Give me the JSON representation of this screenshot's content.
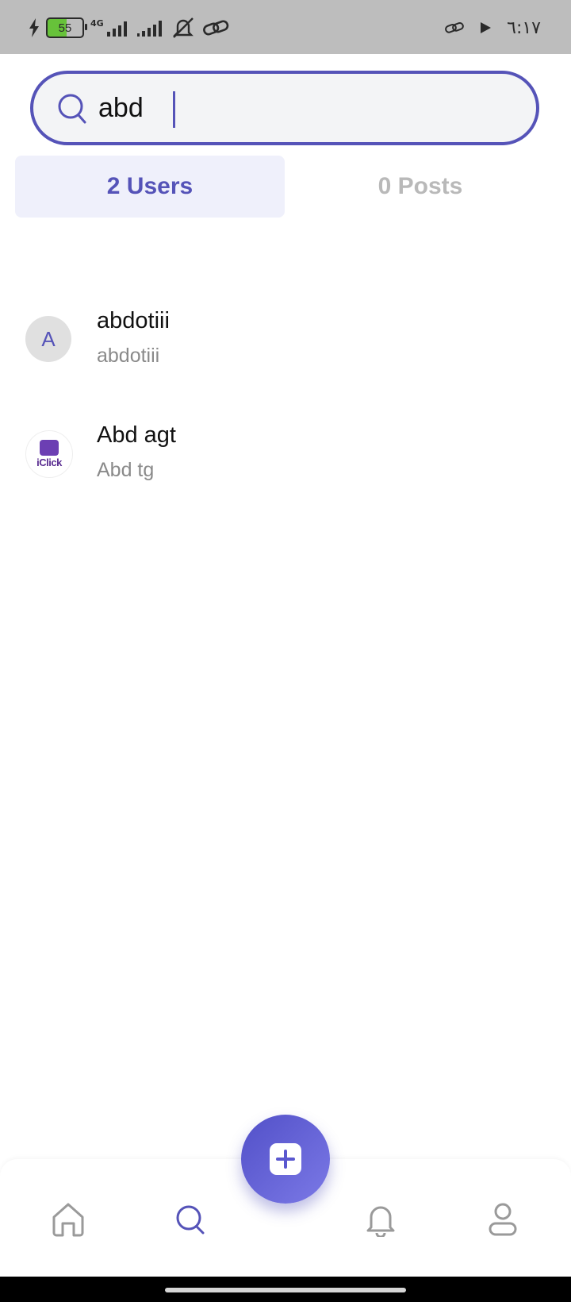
{
  "status_bar": {
    "battery": "55",
    "network": "4G",
    "time": "٦:١٧"
  },
  "search": {
    "value": "abd",
    "placeholder": ""
  },
  "tabs": [
    {
      "label": "2 Users",
      "active": true
    },
    {
      "label": "0 Posts",
      "active": false
    }
  ],
  "results": [
    {
      "name": "abdotiii",
      "handle": "abdotiii",
      "avatar_letter": "A"
    },
    {
      "name": "Abd agt",
      "handle": "Abd tg",
      "avatar_logo_text": "iClick"
    }
  ],
  "colors": {
    "accent": "#5553b8",
    "tab_active_bg": "#eff0fb",
    "inactive_text": "#b9b9b9"
  },
  "nav": {
    "items": [
      "home-icon",
      "search-icon",
      "add-icon",
      "bell-icon",
      "profile-icon"
    ],
    "active": "search-icon"
  }
}
